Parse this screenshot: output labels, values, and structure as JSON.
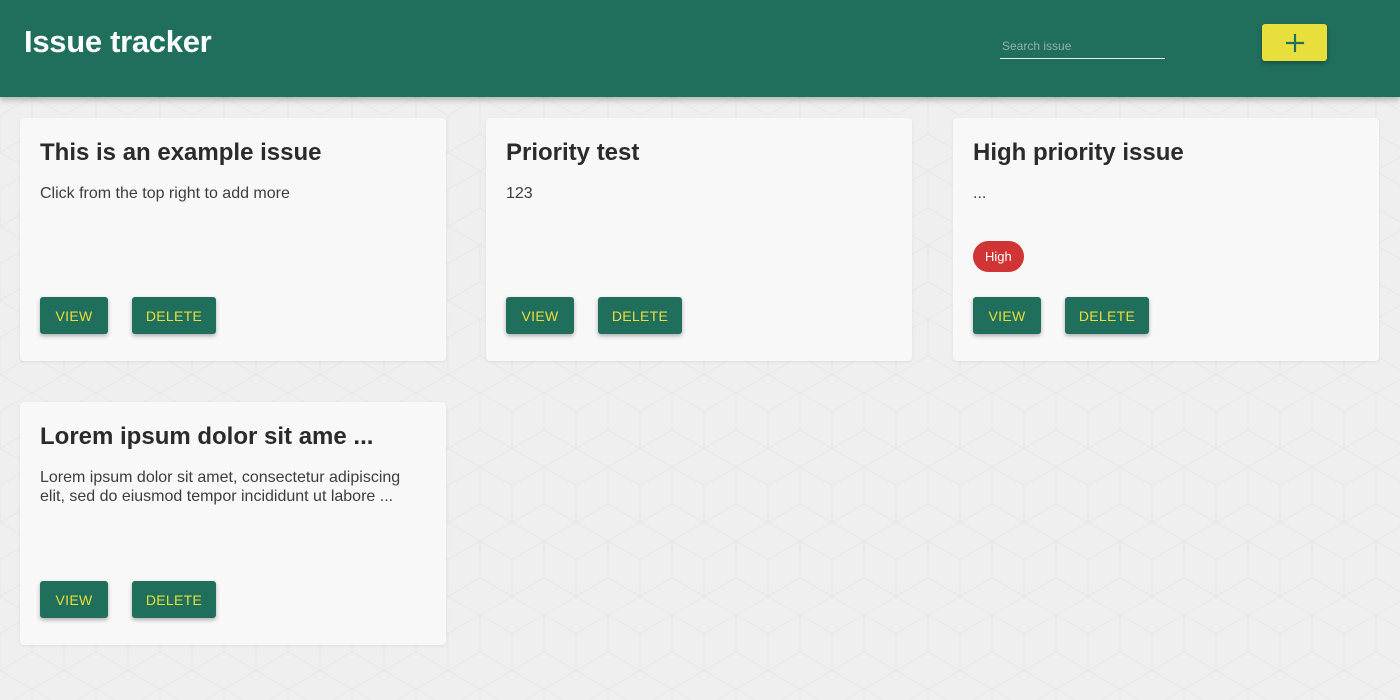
{
  "header": {
    "title": "Issue tracker",
    "search_placeholder": "Search issue",
    "add_icon": "plus-icon"
  },
  "colors": {
    "primary": "#1f6f5c",
    "accent": "#e8df3c",
    "badge_high": "#d13434",
    "card_bg": "#f8f8f8",
    "page_bg": "#efefef"
  },
  "issues": [
    {
      "title": "This is an example issue",
      "description": "Click from the top right to add more",
      "priority": "",
      "view_label": "VIEW",
      "delete_label": "DELETE"
    },
    {
      "title": "Priority test",
      "description": "123",
      "priority": "",
      "view_label": "VIEW",
      "delete_label": "DELETE"
    },
    {
      "title": "High priority issue",
      "description": "...",
      "priority": "High",
      "view_label": "VIEW",
      "delete_label": "DELETE"
    },
    {
      "title": "Lorem ipsum dolor sit ame ...",
      "description": "Lorem ipsum dolor sit amet, consectetur adipiscing elit, sed do eiusmod tempor incididunt ut labore ...",
      "priority": "",
      "view_label": "VIEW",
      "delete_label": "DELETE"
    }
  ]
}
